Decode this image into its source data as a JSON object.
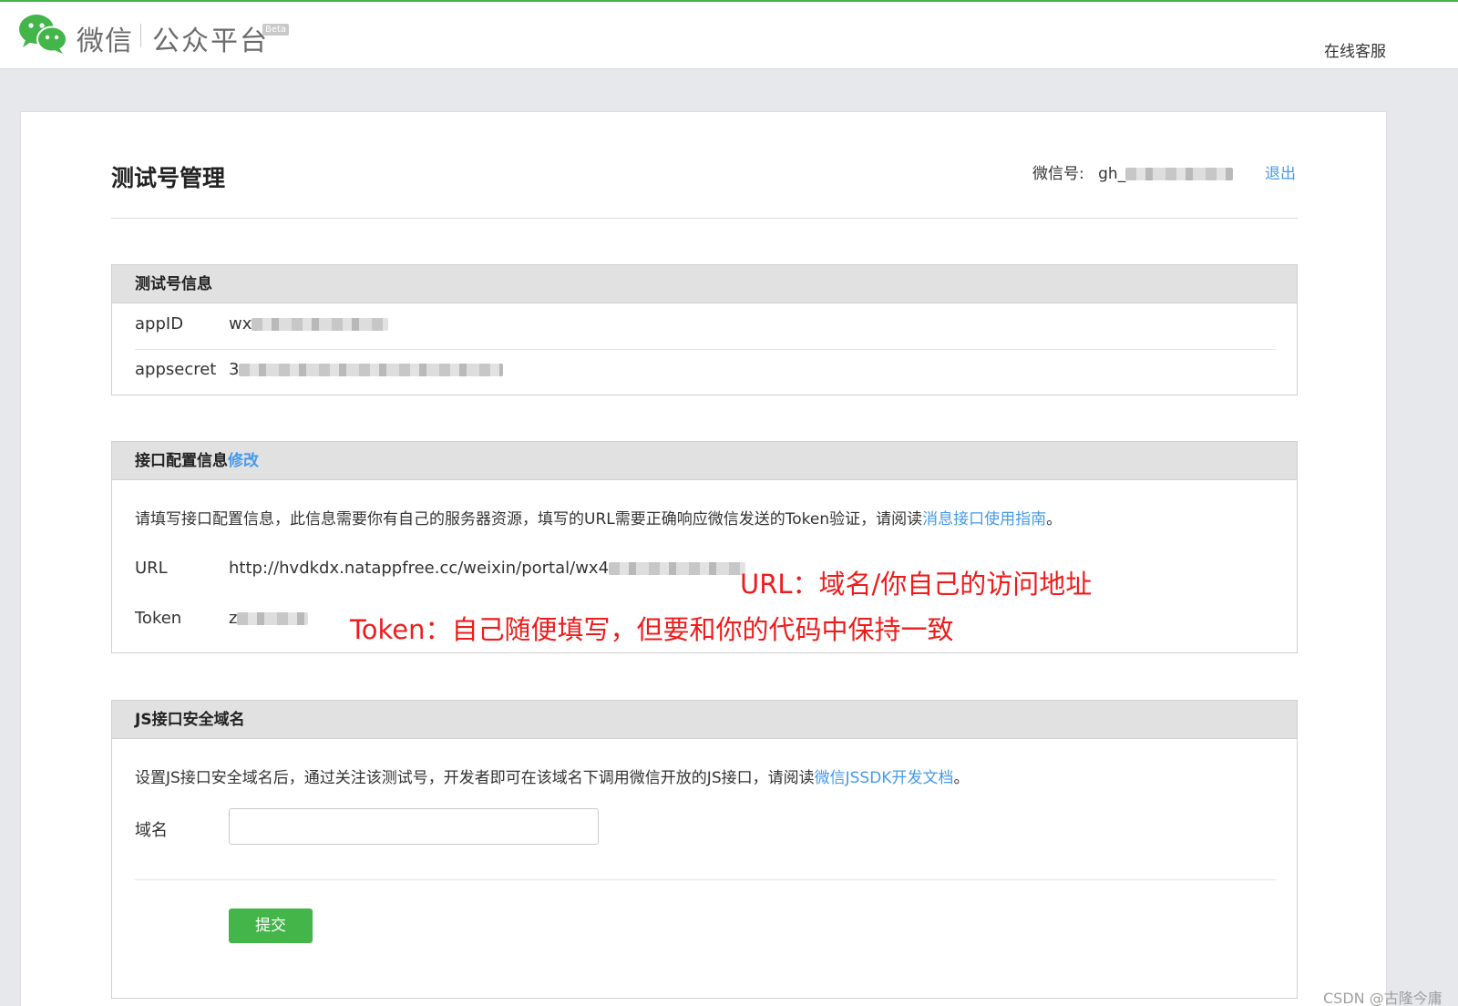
{
  "header": {
    "brand": "微信",
    "brand_sub": "公众平台",
    "beta": "Beta",
    "support_link": "在线客服"
  },
  "page": {
    "title": "测试号管理",
    "account_label": "微信号:",
    "account_value_prefix": "gh_",
    "logout": "退出"
  },
  "test_info": {
    "title": "测试号信息",
    "rows": [
      {
        "label": "appID",
        "value_prefix": "wx"
      },
      {
        "label": "appsecret",
        "value_prefix": "3"
      }
    ]
  },
  "api_config": {
    "title": "接口配置信息",
    "edit_link": "修改",
    "description": "请填写接口配置信息，此信息需要你有自己的服务器资源，填写的URL需要正确响应微信发送的Token验证，请阅读",
    "description_link": "消息接口使用指南",
    "description_end": "。",
    "url_label": "URL",
    "url_value": "http://hvdkdx.natappfree.cc/weixin/portal/wx4",
    "token_label": "Token",
    "token_value_prefix": "z",
    "annotation_url": "URL：域名/你自己的访问地址",
    "annotation_token": "Token：自己随便填写，但要和你的代码中保持一致"
  },
  "js_domain": {
    "title": "JS接口安全域名",
    "description": "设置JS接口安全域名后，通过关注该测试号，开发者即可在该域名下调用微信开放的JS接口，请阅读",
    "description_link": "微信JSSDK开发文档",
    "description_end": "。",
    "domain_label": "域名",
    "domain_value": "",
    "submit_label": "提交"
  },
  "watermark": "CSDN @古隆今庸",
  "colors": {
    "brand_green": "#44b549",
    "link_blue": "#459ae9",
    "annotation_red": "#ee1c1c"
  }
}
